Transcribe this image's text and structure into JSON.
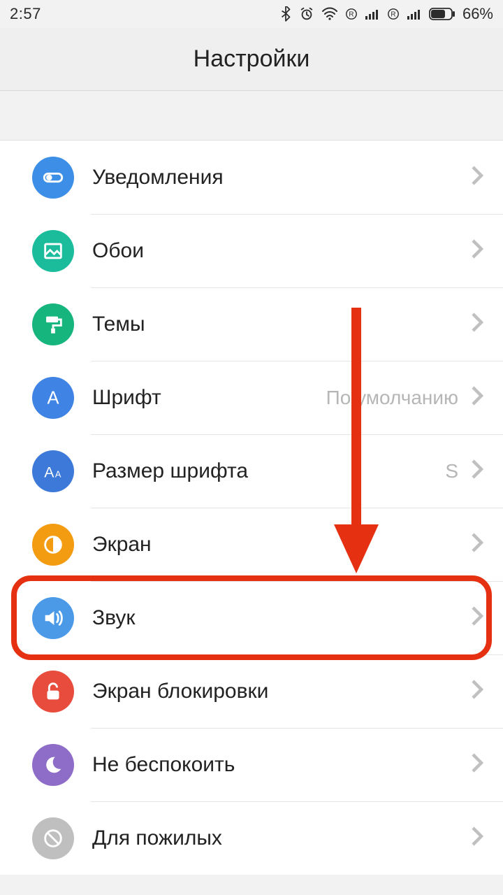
{
  "status": {
    "time": "2:57",
    "battery_pct": "66%"
  },
  "header": {
    "title": "Настройки"
  },
  "items": [
    {
      "label": "Уведомления",
      "value": ""
    },
    {
      "label": "Обои",
      "value": ""
    },
    {
      "label": "Темы",
      "value": ""
    },
    {
      "label": "Шрифт",
      "value": "По умолчанию"
    },
    {
      "label": "Размер шрифта",
      "value": "S"
    },
    {
      "label": "Экран",
      "value": ""
    },
    {
      "label": "Звук",
      "value": ""
    },
    {
      "label": "Экран блокировки",
      "value": ""
    },
    {
      "label": "Не беспокоить",
      "value": ""
    },
    {
      "label": "Для пожилых",
      "value": ""
    }
  ]
}
